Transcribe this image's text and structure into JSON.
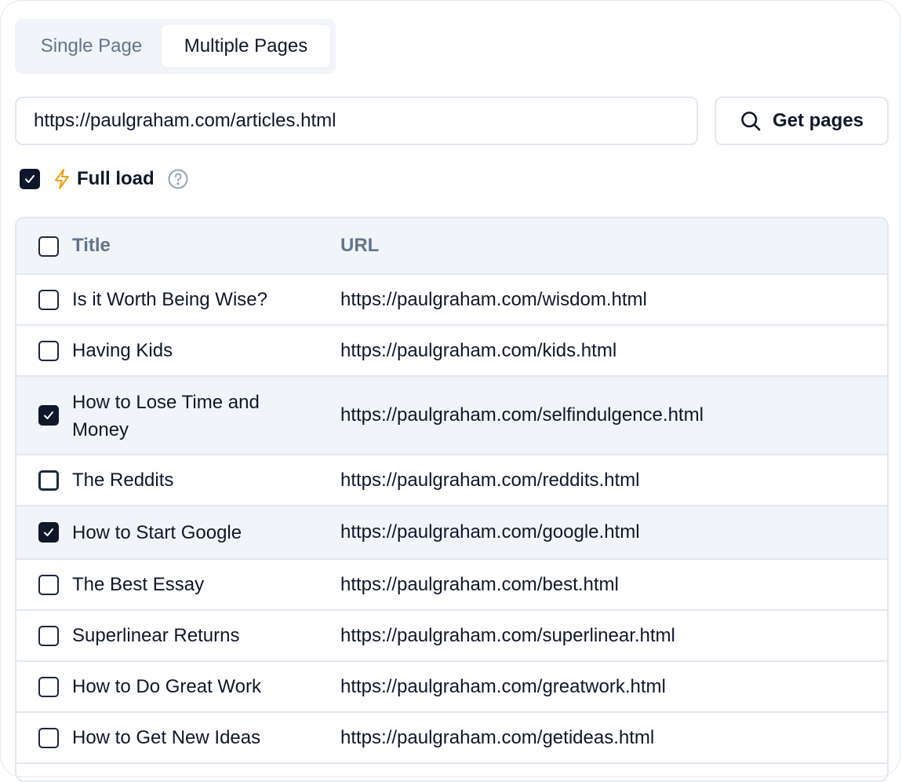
{
  "tabs": {
    "single": "Single Page",
    "multiple": "Multiple Pages",
    "active": "multiple"
  },
  "url_input": {
    "value": "https://paulgraham.com/articles.html",
    "placeholder": ""
  },
  "get_pages_button": {
    "label": "Get pages",
    "icon": "search-icon"
  },
  "full_load": {
    "checked": true,
    "icon": "lightning-bolt-icon",
    "label": "Full load",
    "help_icon": "question-circle-icon"
  },
  "table": {
    "headers": {
      "title": "Title",
      "url": "URL"
    },
    "rows": [
      {
        "title": "Is it Worth Being Wise?",
        "url": "https://paulgraham.com/wisdom.html",
        "checked": false
      },
      {
        "title": "Having Kids",
        "url": "https://paulgraham.com/kids.html",
        "checked": false
      },
      {
        "title": "How to Lose Time and Money",
        "url": "https://paulgraham.com/selfindulgence.html",
        "checked": true
      },
      {
        "title": "The Reddits",
        "url": "https://paulgraham.com/reddits.html",
        "checked": false
      },
      {
        "title": "How to Start Google",
        "url": "https://paulgraham.com/google.html",
        "checked": true
      },
      {
        "title": "The Best Essay",
        "url": "https://paulgraham.com/best.html",
        "checked": false
      },
      {
        "title": "Superlinear Returns",
        "url": "https://paulgraham.com/superlinear.html",
        "checked": false
      },
      {
        "title": "How to Do Great Work",
        "url": "https://paulgraham.com/greatwork.html",
        "checked": false
      },
      {
        "title": "How to Get New Ideas",
        "url": "https://paulgraham.com/getideas.html",
        "checked": false
      }
    ]
  },
  "colors": {
    "accent": "#0f172a",
    "muted": "#64748b",
    "border": "#e2e8f0",
    "header_bg": "#f1f5f9",
    "bolt": "#f59e0b"
  }
}
